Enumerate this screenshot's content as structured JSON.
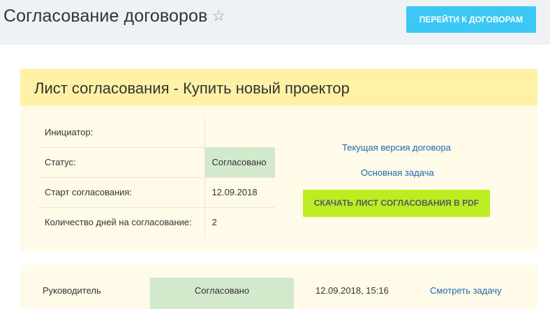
{
  "header": {
    "title": "Согласование договоров",
    "star_icon": "☆",
    "goto_button": "ПЕРЕЙТИ К ДОГОВОРАМ"
  },
  "card": {
    "title": "Лист согласования - Купить новый проектор",
    "rows": [
      {
        "label": "Инициатор:",
        "value": ""
      },
      {
        "label": "Статус:",
        "value": "Согласовано"
      },
      {
        "label": "Старт согласования:",
        "value": "12.09.2018"
      },
      {
        "label": "Количество дней на согласование:",
        "value": "2"
      }
    ],
    "links": {
      "current_contract": "Текущая версия договора",
      "main_task": "Основная задача"
    },
    "pdf_button": "СКАЧАТЬ ЛИСТ СОГЛАСОВАНИЯ В PDF"
  },
  "approvals": [
    {
      "role": "Руководитель",
      "status": "Согласовано",
      "date": "12.09.2018, 15:16",
      "link": "Смотреть задачу"
    }
  ],
  "colors": {
    "accent_blue": "#3bc8f5",
    "pdf_green": "#bbed21",
    "status_green": "#d3e9cc",
    "card_header": "#fff2a6",
    "card_body": "#fffbe8"
  }
}
